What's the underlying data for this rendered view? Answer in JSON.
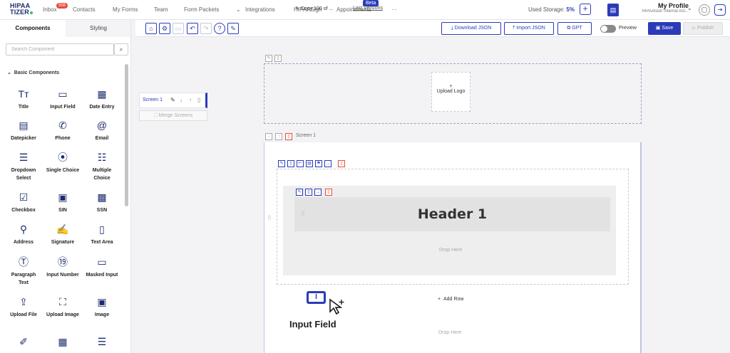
{
  "brand": {
    "line1": "HIPAA",
    "line2": "TIZER"
  },
  "nav": {
    "inbox": "Inbox",
    "inbox_badge": "558",
    "contacts": "Contacts",
    "my_forms": "My Forms",
    "team": "Team",
    "form_packets": "Form Packets",
    "integrations": "Integrations",
    "hipaasign": "HIPAASign",
    "appointments": "Appointments",
    "beta": "Beta",
    "more": "···"
  },
  "storage": {
    "label": "Used Storage:",
    "value": "5%"
  },
  "profile": {
    "name": "My Profile",
    "subtitle": "HIPAAtizer Internal Act..."
  },
  "toolbar": {
    "copy_label": "Copy 100 of ...",
    "last_versions": "Last Versions",
    "download_json": "Download JSON",
    "import_json": "Import JSON",
    "gpt": "GPT",
    "preview": "Preview",
    "save": "Save",
    "publish": "Publish"
  },
  "left_panel": {
    "tabs": [
      "Components",
      "Styling"
    ],
    "search_placeholder": "Search Component",
    "section": "Basic Components",
    "components": [
      {
        "label": "Title",
        "icon": "title-icon"
      },
      {
        "label": "Input Field",
        "icon": "input-field-icon"
      },
      {
        "label": "Date Entry",
        "icon": "date-entry-icon"
      },
      {
        "label": "Datepicker",
        "icon": "calendar-icon"
      },
      {
        "label": "Phone",
        "icon": "phone-icon"
      },
      {
        "label": "Email",
        "icon": "at-icon"
      },
      {
        "label": "Dropdown Select",
        "icon": "dropdown-icon"
      },
      {
        "label": "Single Choice",
        "icon": "single-choice-icon"
      },
      {
        "label": "Multiple Choice",
        "icon": "multiple-choice-icon"
      },
      {
        "label": "Checkbox",
        "icon": "checkbox-icon"
      },
      {
        "label": "SIN",
        "icon": "id-card-icon"
      },
      {
        "label": "SSN",
        "icon": "ssn-card-icon"
      },
      {
        "label": "Address",
        "icon": "map-pin-icon"
      },
      {
        "label": "Signature",
        "icon": "signature-icon"
      },
      {
        "label": "Text Area",
        "icon": "text-area-icon"
      },
      {
        "label": "Paragraph Text",
        "icon": "paragraph-icon"
      },
      {
        "label": "Input Number",
        "icon": "input-number-icon"
      },
      {
        "label": "Masked Input",
        "icon": "masked-input-icon"
      },
      {
        "label": "Upload File",
        "icon": "upload-file-icon"
      },
      {
        "label": "Upload Image",
        "icon": "upload-image-icon"
      },
      {
        "label": "Image",
        "icon": "image-icon"
      }
    ]
  },
  "screens": {
    "item": "Screen 1",
    "merge": "Merge Screens"
  },
  "canvas": {
    "upload_logo": "Upload Logo",
    "screen_label": "Screen 1",
    "header": "Header 1",
    "drop_here": "Drop Here",
    "add_row": "Add Row",
    "dragging_label": "Input Field"
  },
  "colors": {
    "accent": "#2b3bb8",
    "danger": "#e74c3c"
  }
}
